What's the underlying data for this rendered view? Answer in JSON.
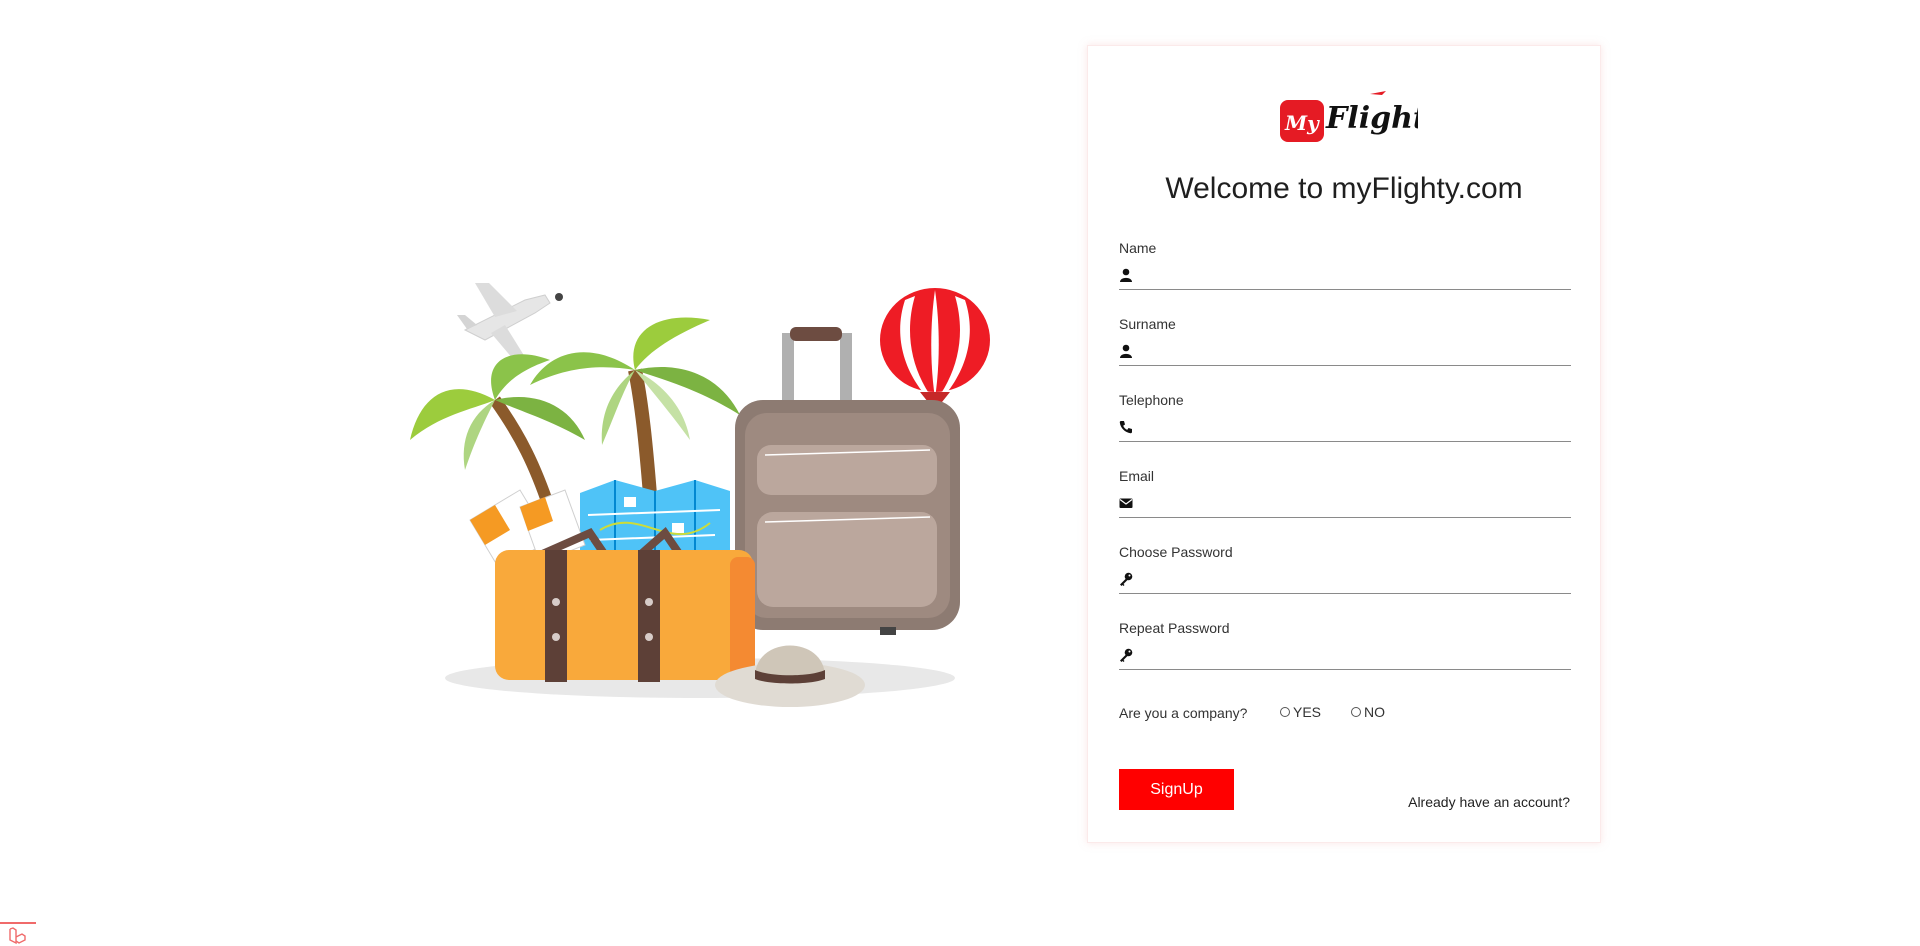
{
  "brand": {
    "logo_text_my": "My",
    "logo_text_flighty": "Flighty",
    "accent_color": "#ff0000"
  },
  "form": {
    "title": "Welcome to myFlighty.com",
    "fields": [
      {
        "label": "Name",
        "icon": "user-icon",
        "value": ""
      },
      {
        "label": "Surname",
        "icon": "user-icon",
        "value": ""
      },
      {
        "label": "Telephone",
        "icon": "phone-icon",
        "value": ""
      },
      {
        "label": "Email",
        "icon": "envelope-icon",
        "value": ""
      },
      {
        "label": "Choose Password",
        "icon": "key-icon",
        "value": ""
      },
      {
        "label": "Repeat Password",
        "icon": "key-icon",
        "value": ""
      }
    ],
    "company_question": "Are you a company?",
    "company_options": [
      "YES",
      "NO"
    ],
    "submit_label": "SignUp",
    "login_link": "Already have an account?"
  },
  "illustration": {
    "icons": [
      "airplane-icon",
      "palm-trees",
      "hot-air-balloon",
      "suitcase",
      "trolley-bag",
      "map",
      "tickets",
      "hat"
    ]
  },
  "corner": {
    "icon": "laravel-icon"
  }
}
